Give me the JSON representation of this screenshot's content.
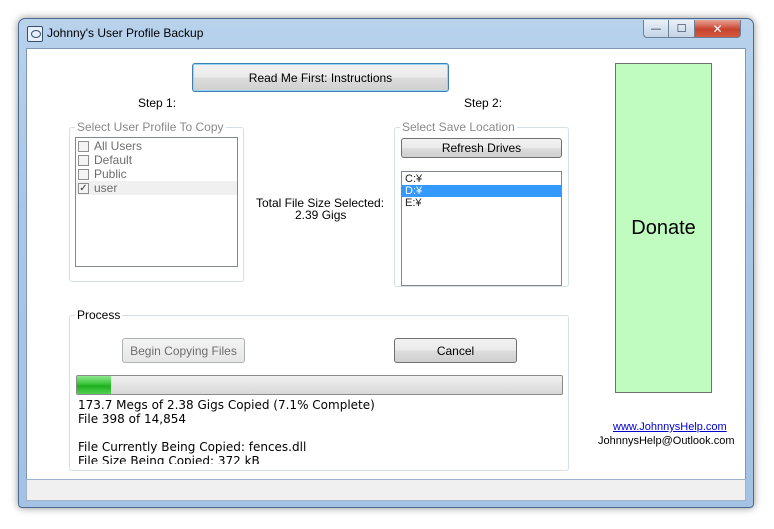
{
  "window": {
    "title": "Johnny's User Profile Backup",
    "controls": {
      "minimize": "—",
      "maximize": "☐",
      "close": "✕"
    }
  },
  "readme_button": "Read Me First:  Instructions",
  "step1_label": "Step 1:",
  "step2_label": "Step 2:",
  "profile_group": {
    "caption": "Select User Profile To Copy",
    "items": [
      {
        "label": "All Users",
        "checked": false
      },
      {
        "label": "Default",
        "checked": false
      },
      {
        "label": "Public",
        "checked": false
      },
      {
        "label": "user",
        "checked": true
      }
    ]
  },
  "total_size": {
    "label": "Total File Size Selected:",
    "value": "2.39 Gigs"
  },
  "save_group": {
    "caption": "Select Save Location",
    "refresh_button": "Refresh Drives",
    "drives": [
      {
        "label": "C:¥",
        "selected": false
      },
      {
        "label": "D:¥",
        "selected": true
      },
      {
        "label": "E:¥",
        "selected": false
      }
    ]
  },
  "process": {
    "caption": "Process",
    "begin_button": "Begin Copying Files",
    "cancel_button": "Cancel",
    "progress_percent": 7.1,
    "copied_text": "173.7 Megs of 2.38 Gigs Copied (7.1% Complete)",
    "file_count_text": "File 398 of 14,854",
    "current_file_text": "File Currently Being Copied: fences.dll",
    "current_size_text": "File Size Being Copied: 372 kB"
  },
  "donate_button": "Donate",
  "website_link": "www.JohnnysHelp.com",
  "email": "JohnnysHelp@Outlook.com",
  "colors": {
    "donate_bg": "#c0fcc0",
    "progress_green": "#37c437",
    "selection_blue": "#3399ff",
    "link_blue": "#0000cc"
  }
}
